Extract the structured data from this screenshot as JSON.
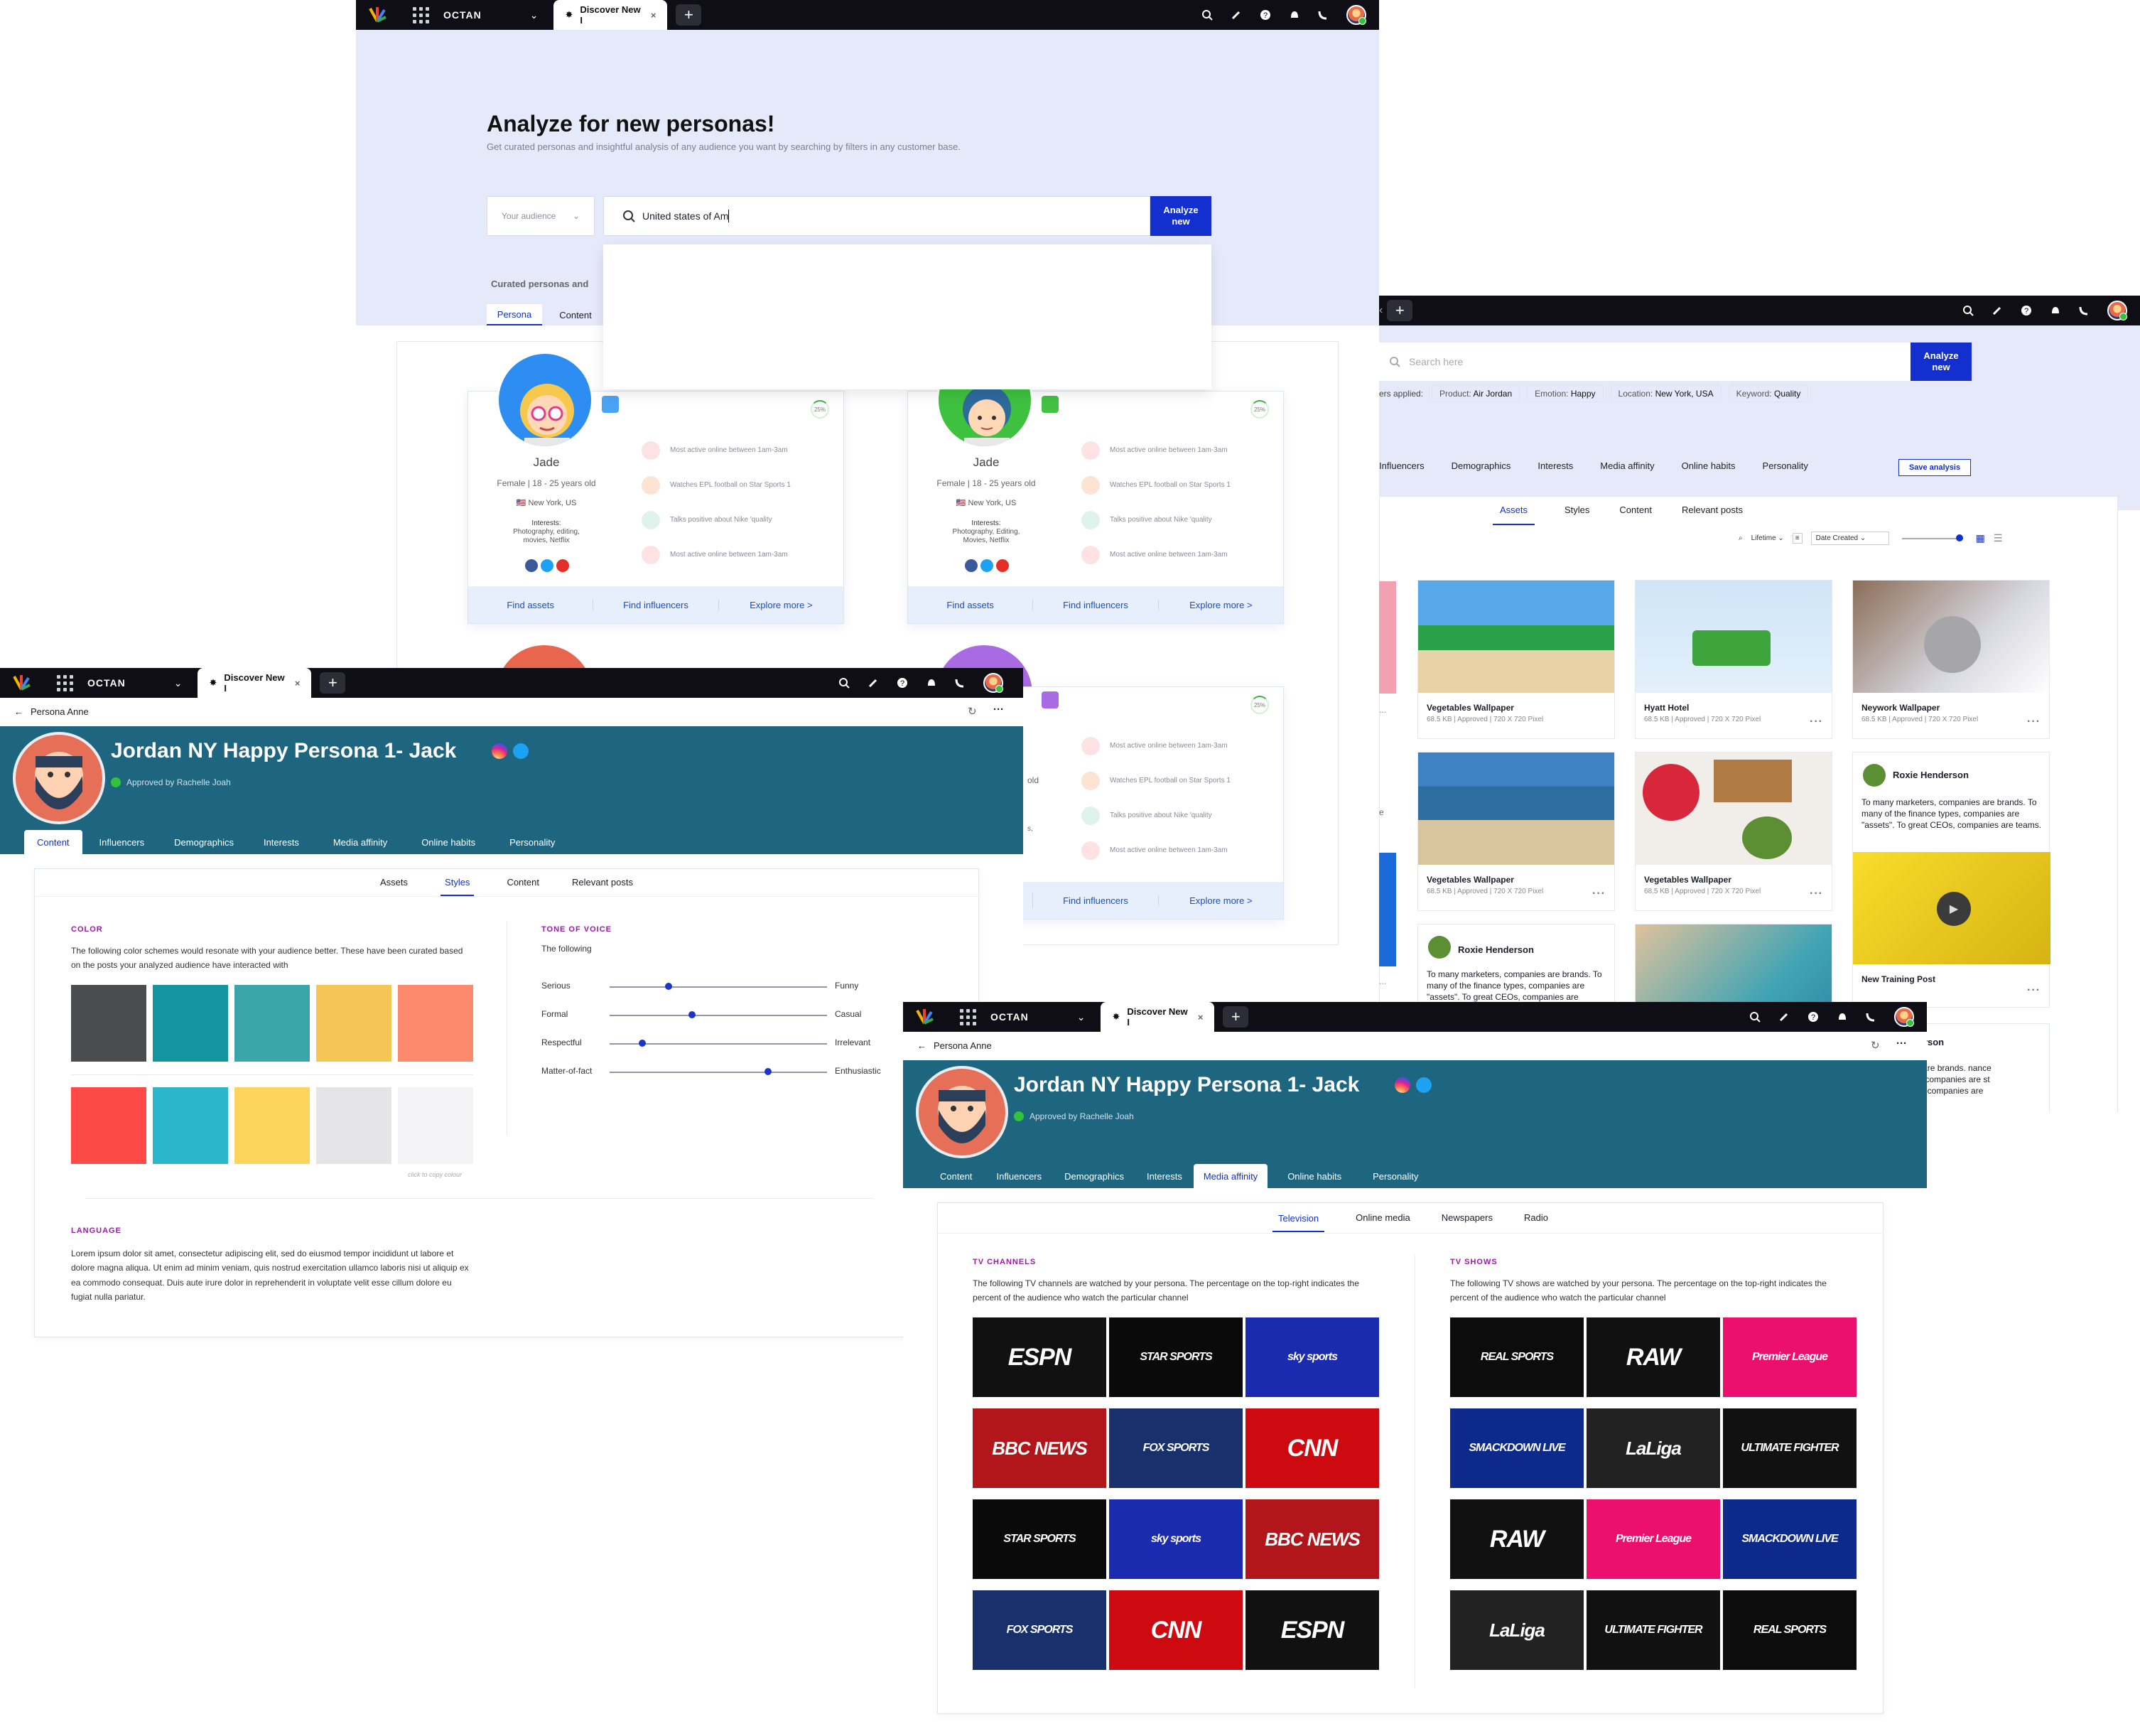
{
  "colors": {
    "accent": "#1330cf",
    "teal_banner": "#1e6580",
    "lavender": "#e6e9fa"
  },
  "main_window": {
    "app_name": "OCTAN",
    "tab_title": "Discover New I",
    "heading": "Analyze for new personas!",
    "subheading": "Get curated personas and insightful analysis of any audience you want by searching by filters in any customer base.",
    "audience_select": "Your audience",
    "search_value": "United states of Am",
    "analyze_btn": "Analyze new",
    "curated_label": "Curated personas and",
    "tabs": [
      "Persona",
      "Content"
    ],
    "persona_cards": [
      {
        "name": "Jade",
        "meta": "Female | 18 - 25 years old",
        "location": "New York, US",
        "interests_label": "Interests:",
        "interests": "Photography, editing, movies, Netflix",
        "badge": "25%"
      },
      {
        "name": "Jade",
        "meta": "Female | 18 - 25 years old",
        "location": "New York, US",
        "interests_label": "Interests:",
        "interests": "Photography, Editing, Movies, Netflix",
        "badge": "25%"
      }
    ],
    "card_insights": [
      "Most active online between 1am-3am",
      "Watches EPL football on Star Sports 1",
      "Talks positive about Nike 'quality",
      "Most active online between 1am-3am"
    ],
    "card_actions": [
      "Find assets",
      "Find influencers",
      "Explore more >"
    ],
    "third_card": {
      "badge": "25%",
      "age_partial": "old",
      "interests_partial": "s,",
      "actions": [
        "Find influencers",
        "Explore more >"
      ]
    }
  },
  "assets_window": {
    "search_placeholder": "Search here",
    "analyze_btn": "Analyze new",
    "filters_label": "ers applied:",
    "filters": [
      {
        "k": "Product:",
        "v": "Air Jordan"
      },
      {
        "k": "Emotion:",
        "v": "Happy"
      },
      {
        "k": "Location:",
        "v": "New York, USA"
      },
      {
        "k": "Keyword:",
        "v": "Quality"
      }
    ],
    "nav": [
      "Influencers",
      "Demographics",
      "Interests",
      "Media affinity",
      "Online habits",
      "Personality"
    ],
    "save_btn": "Save analysis",
    "subtabs": [
      "Assets",
      "Styles",
      "Content",
      "Relevant posts"
    ],
    "lifetime": "Lifetime",
    "sort": "Date Created",
    "assets": [
      {
        "title": "Vegetables Wallpaper",
        "meta": "68.5 KB | Approved | 720 X 720 Pixel"
      },
      {
        "title": "Hyatt Hotel",
        "meta": "68.5 KB | Approved | 720 X 720 Pixel"
      },
      {
        "title": "Neywork Wallpaper",
        "meta": "68.5 KB | Approved | 720 X 720 Pixel"
      },
      {
        "title": "Vegetables Wallpaper",
        "meta": "68.5 KB | Approved | 720 X 720 Pixel"
      },
      {
        "title": "Vegetables Wallpaper",
        "meta": "68.5 KB | Approved | 720 X 720 Pixel"
      }
    ],
    "post": {
      "author": "Roxie Henderson",
      "text": "To many marketers, companies are brands. To many of the finance types, companies are \"assets\". To great CEOs, companies are teams.",
      "video_title": "New Training Post"
    },
    "post2": {
      "author": "Roxie Henderson",
      "text": "To many marketers, companies are brands. To many of the finance types, companies are \"assets\". To great CEOs, companies are"
    },
    "post3": {
      "author": "lenderson",
      "text": "anies are brands. nance types, companies are st CEOs, companies are"
    },
    "edge_dots": "...",
    "edge_letter": "e"
  },
  "styles_window": {
    "app_name": "OCTAN",
    "tab_title": "Discover New I",
    "back": "Persona Anne",
    "persona_title": "Jordan NY Happy Persona 1- Jack",
    "approved": "Approved by Rachelle Joah",
    "nav": [
      "Content",
      "Influencers",
      "Demographics",
      "Interests",
      "Media affinity",
      "Online habits",
      "Personality"
    ],
    "subtabs": [
      "Assets",
      "Styles",
      "Content",
      "Relevant posts"
    ],
    "color_title": "COLOR",
    "color_desc": "The following color schemes would resonate with your audience better. These have been curated based on the posts your analyzed audience have interacted with",
    "swatches": [
      "#4a4d4f",
      "#13949f",
      "#3aa6a9",
      "#f3c655",
      "#fe8a6d",
      "#fe4a47",
      "#2bb7cb",
      "#fdd55c",
      "#e5e5e8",
      "#f4f4f6"
    ],
    "copy_hint": "click to copy colour",
    "tone_title": "TONE OF VOICE",
    "tone_desc": "The following",
    "tones": [
      {
        "left": "Serious",
        "right": "Funny",
        "value": 0.27
      },
      {
        "left": "Formal",
        "right": "Casual",
        "value": 0.38
      },
      {
        "left": "Respectful",
        "right": "Irrelevant",
        "value": 0.15
      },
      {
        "left": "Matter-of-fact",
        "right": "Enthusiastic",
        "value": 0.73
      }
    ],
    "lang_title": "LANGUAGE",
    "lang_text": "Lorem ipsum dolor sit amet, consectetur adipiscing elit, sed do eiusmod tempor incididunt ut labore et dolore magna aliqua. Ut enim ad minim veniam, quis nostrud exercitation ullamco laboris nisi ut aliquip ex ea commodo consequat. Duis aute irure dolor in reprehenderit in voluptate velit esse cillum dolore eu fugiat nulla pariatur."
  },
  "media_window": {
    "app_name": "OCTAN",
    "tab_title": "Discover New I",
    "back": "Persona Anne",
    "persona_title": "Jordan NY Happy Persona 1- Jack",
    "approved": "Approved by Rachelle Joah",
    "nav": [
      "Content",
      "Influencers",
      "Demographics",
      "Interests",
      "Media affinity",
      "Online habits",
      "Personality"
    ],
    "subtabs": [
      "Television",
      "Online media",
      "Newspapers",
      "Radio"
    ],
    "ch_title": "TV CHANNELS",
    "ch_desc": "The following TV channels are watched by your persona. The percentage on the top-right indicates the percent of the audience who watch the particular channel",
    "shows_title": "TV SHOWS",
    "shows_desc": "The following TV shows are watched by your persona. The percentage on the top-right indicates the percent of the audience who watch the particular channel",
    "channels": [
      {
        "label": "ESPN",
        "bg": "#111"
      },
      {
        "label": "STAR SPORTS",
        "bg": "#0a0a0a"
      },
      {
        "label": "sky sports",
        "bg": "#1b2bb0"
      },
      {
        "label": "BBC NEWS",
        "bg": "#b3161a"
      },
      {
        "label": "FOX SPORTS",
        "bg": "#18306b"
      },
      {
        "label": "CNN",
        "bg": "#cc0a0f"
      },
      {
        "label": "STAR SPORTS",
        "bg": "#0a0a0a"
      },
      {
        "label": "sky sports",
        "bg": "#1b2bb0"
      },
      {
        "label": "BBC NEWS",
        "bg": "#b3161a"
      },
      {
        "label": "FOX SPORTS",
        "bg": "#18306b"
      },
      {
        "label": "CNN",
        "bg": "#cc0a0f"
      },
      {
        "label": "ESPN",
        "bg": "#111"
      }
    ],
    "shows": [
      {
        "label": "REAL SPORTS",
        "bg": "#0c0c0c"
      },
      {
        "label": "RAW",
        "bg": "#111"
      },
      {
        "label": "Premier League",
        "bg": "#ec0f6d"
      },
      {
        "label": "SMACKDOWN LIVE",
        "bg": "#0d2a8a"
      },
      {
        "label": "LaLiga",
        "bg": "#222"
      },
      {
        "label": "ULTIMATE FIGHTER",
        "bg": "#111"
      },
      {
        "label": "RAW",
        "bg": "#111"
      },
      {
        "label": "Premier League",
        "bg": "#ec0f6d"
      },
      {
        "label": "SMACKDOWN LIVE",
        "bg": "#0d2a8a"
      },
      {
        "label": "LaLiga",
        "bg": "#222"
      },
      {
        "label": "ULTIMATE FIGHTER",
        "bg": "#111"
      },
      {
        "label": "REAL SPORTS",
        "bg": "#0c0c0c"
      }
    ]
  }
}
